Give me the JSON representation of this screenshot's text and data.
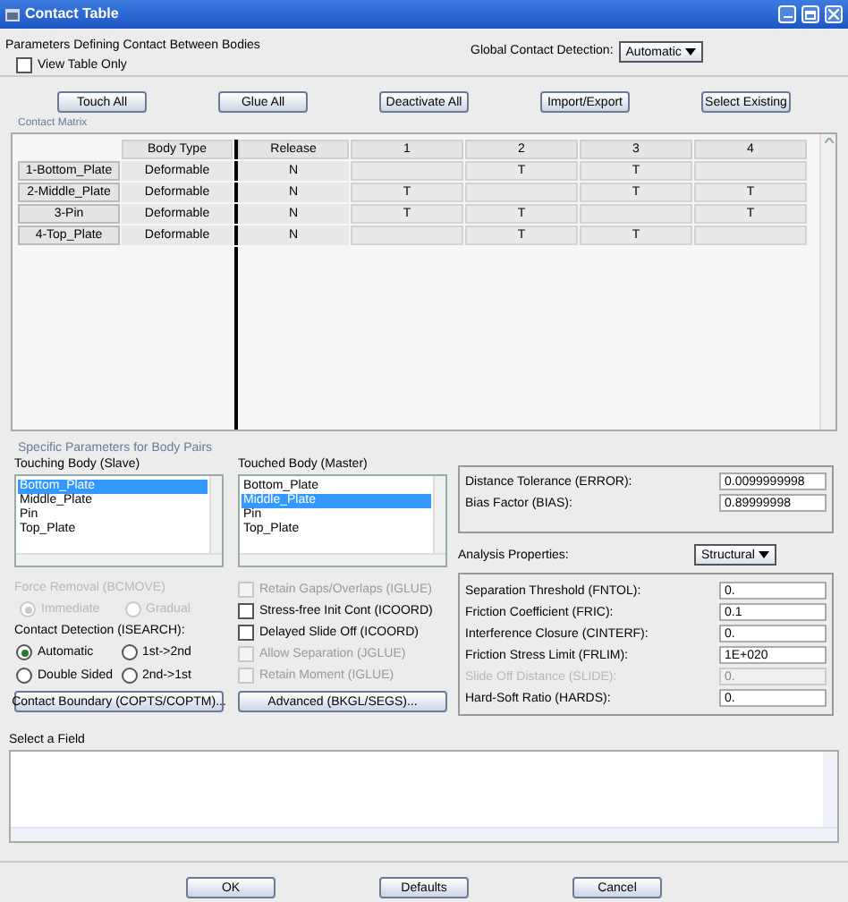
{
  "window": {
    "title": "Contact Table"
  },
  "header": {
    "label": "Parameters Defining Contact Between Bodies",
    "view_table_only": {
      "label": "View Table Only",
      "checked": false
    },
    "global_detection": {
      "label": "Global Contact Detection:",
      "value": "Automatic"
    }
  },
  "top_buttons": [
    "Touch All",
    "Glue All",
    "Deactivate All",
    "Import/Export",
    "Select Existing"
  ],
  "matrix": {
    "title": "Contact Matrix",
    "columns": [
      "",
      "Body Type",
      "Release",
      "1",
      "2",
      "3",
      "4"
    ],
    "rows": [
      {
        "cells": [
          "1-Bottom_Plate",
          "Deformable",
          "N",
          "",
          "T",
          "T",
          ""
        ]
      },
      {
        "cells": [
          "2-Middle_Plate",
          "Deformable",
          "N",
          "T",
          "",
          "T",
          "T"
        ]
      },
      {
        "cells": [
          "3-Pin",
          "Deformable",
          "N",
          "T",
          "T",
          "",
          "T"
        ]
      },
      {
        "cells": [
          "4-Top_Plate",
          "Deformable",
          "N",
          "",
          "T",
          "T",
          ""
        ]
      }
    ]
  },
  "body_pairs": {
    "title": "Specific Parameters for Body Pairs",
    "touching": {
      "label": "Touching Body (Slave)",
      "items": [
        {
          "label": "Bottom_Plate",
          "selected": true
        },
        {
          "label": "Middle_Plate",
          "selected": false
        },
        {
          "label": "Pin",
          "selected": false
        },
        {
          "label": "Top_Plate",
          "selected": false
        }
      ]
    },
    "touched": {
      "label": "Touched Body (Master)",
      "items": [
        {
          "label": "Bottom_Plate",
          "selected": false
        },
        {
          "label": "Middle_Plate",
          "selected": true
        },
        {
          "label": "Pin",
          "selected": false
        },
        {
          "label": "Top_Plate",
          "selected": false
        }
      ]
    },
    "force_removal": {
      "label": "Force Removal (BCMOVE)",
      "disabled": true,
      "options": [
        {
          "label": "Immediate",
          "selected": true
        },
        {
          "label": "Gradual",
          "selected": false
        }
      ]
    },
    "contact_detection": {
      "label": "Contact Detection (ISEARCH):",
      "disabled": false,
      "options": [
        {
          "label": "Automatic",
          "selected": true
        },
        {
          "label": "1st->2nd",
          "selected": false
        },
        {
          "label": "Double Sided",
          "selected": false
        },
        {
          "label": "2nd->1st",
          "selected": false
        }
      ]
    },
    "checkboxes": [
      {
        "label": "Retain Gaps/Overlaps (IGLUE)",
        "checked": false,
        "disabled": true
      },
      {
        "label": "Stress-free Init Cont (ICOORD)",
        "checked": false,
        "disabled": false
      },
      {
        "label": "Delayed Slide Off (ICOORD)",
        "checked": false,
        "disabled": false
      },
      {
        "label": "Allow Separation (JGLUE)",
        "checked": false,
        "disabled": true
      },
      {
        "label": "Retain Moment (IGLUE)",
        "checked": false,
        "disabled": true
      }
    ],
    "contact_boundary_button": "Contact Boundary (COPTS/COPTM)...",
    "advanced_button": "Advanced (BKGL/SEGS)...",
    "tolerances": [
      {
        "label": "Distance Tolerance (ERROR):",
        "value": "0.0099999998",
        "disabled": false
      },
      {
        "label": "Bias Factor (BIAS):",
        "value": "0.89999998",
        "disabled": false
      }
    ],
    "analysis": {
      "label": "Analysis Properties:",
      "value": "Structural"
    },
    "properties": [
      {
        "label": "Separation Threshold (FNTOL):",
        "value": "0.",
        "disabled": false
      },
      {
        "label": "Friction Coefficient (FRIC):",
        "value": "0.1",
        "disabled": false
      },
      {
        "label": "Interference Closure (CINTERF):",
        "value": "0.",
        "disabled": false
      },
      {
        "label": "Friction Stress Limit (FRLIM):",
        "value": "1E+020",
        "disabled": false
      },
      {
        "label": "Slide Off Distance (SLIDE):",
        "value": "0.",
        "disabled": true
      },
      {
        "label": "Hard-Soft Ratio (HARDS):",
        "value": "0.",
        "disabled": false
      }
    ]
  },
  "select_field": {
    "label": "Select a Field"
  },
  "footer_buttons": [
    "OK",
    "Defaults",
    "Cancel"
  ]
}
